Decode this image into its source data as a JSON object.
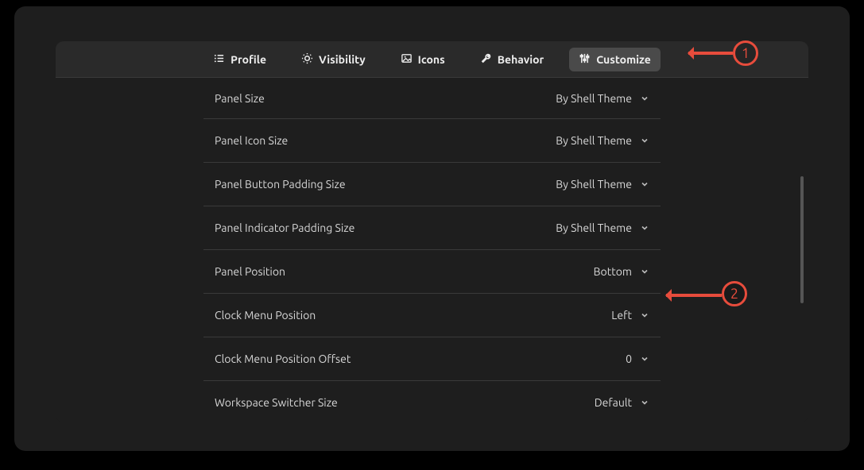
{
  "tabs": [
    {
      "label": "Profile",
      "icon": "list-icon"
    },
    {
      "label": "Visibility",
      "icon": "sun-icon"
    },
    {
      "label": "Icons",
      "icon": "image-icon"
    },
    {
      "label": "Behavior",
      "icon": "wrench-icon"
    },
    {
      "label": "Customize",
      "icon": "sliders-icon"
    }
  ],
  "active_tab": "Customize",
  "settings": [
    {
      "label": "Panel Size",
      "value": "By Shell Theme"
    },
    {
      "label": "Panel Icon Size",
      "value": "By Shell Theme"
    },
    {
      "label": "Panel Button Padding Size",
      "value": "By Shell Theme"
    },
    {
      "label": "Panel Indicator Padding Size",
      "value": "By Shell Theme"
    },
    {
      "label": "Panel Position",
      "value": "Bottom"
    },
    {
      "label": "Clock Menu Position",
      "value": "Left"
    },
    {
      "label": "Clock Menu Position Offset",
      "value": "0"
    },
    {
      "label": "Workspace Switcher Size",
      "value": "Default"
    }
  ],
  "annotations": {
    "callout1": "1",
    "callout2": "2"
  },
  "colors": {
    "background": "#1e1e1e",
    "tabbar": "#2a2a2a",
    "text": "#d8d8d8",
    "accent": "#e74c3c"
  }
}
